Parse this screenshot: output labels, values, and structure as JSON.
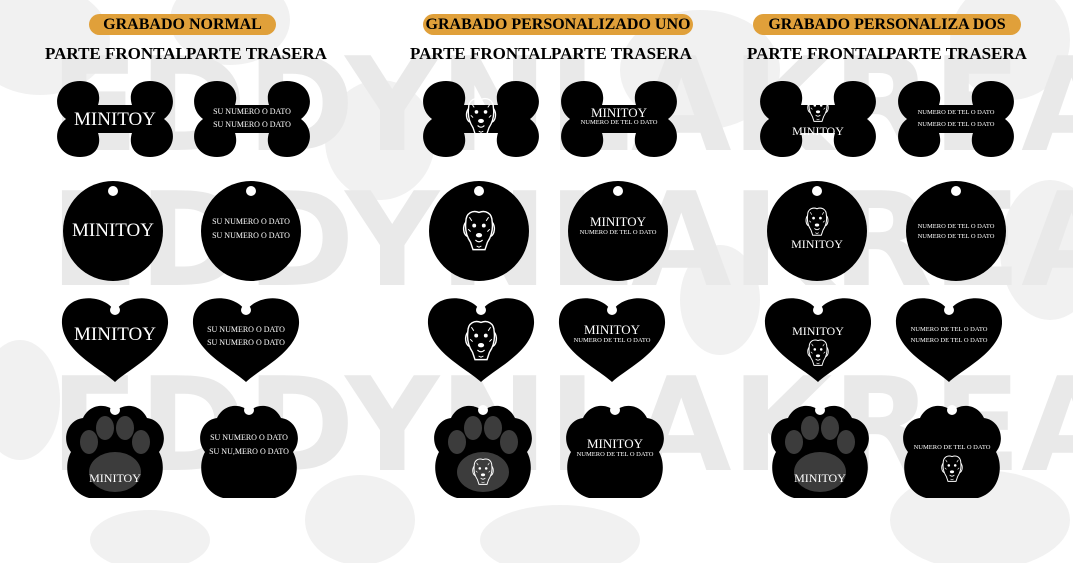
{
  "sections": [
    {
      "title": "GRABADO NORMAL"
    },
    {
      "title": "GRABADO PERSONALIZADO UNO"
    },
    {
      "title": "GRABADO PERSONALIZA DOS"
    }
  ],
  "column_headers": {
    "front": "PARTE FRONTAL",
    "back": "PARTE TRASERA"
  },
  "normal": {
    "front_name": "MINITOY",
    "back_line": "SU NUMERO O DATO",
    "paw_back_line2": "SU NU,MERO O DATO"
  },
  "uno": {
    "name": "MINITOY",
    "back_line": "NUMERO DE TEL O DATO"
  },
  "dos": {
    "name": "MINITOY",
    "back_line": "NUMERO DE TEL O DATO"
  },
  "watermark_text": "EDDYNLAKREAS",
  "colors": {
    "banner": "#e0a03a",
    "tag": "#000000",
    "engrave": "#ffffff"
  },
  "icons": [
    "dog-portrait-icon",
    "paw-print-icon"
  ]
}
